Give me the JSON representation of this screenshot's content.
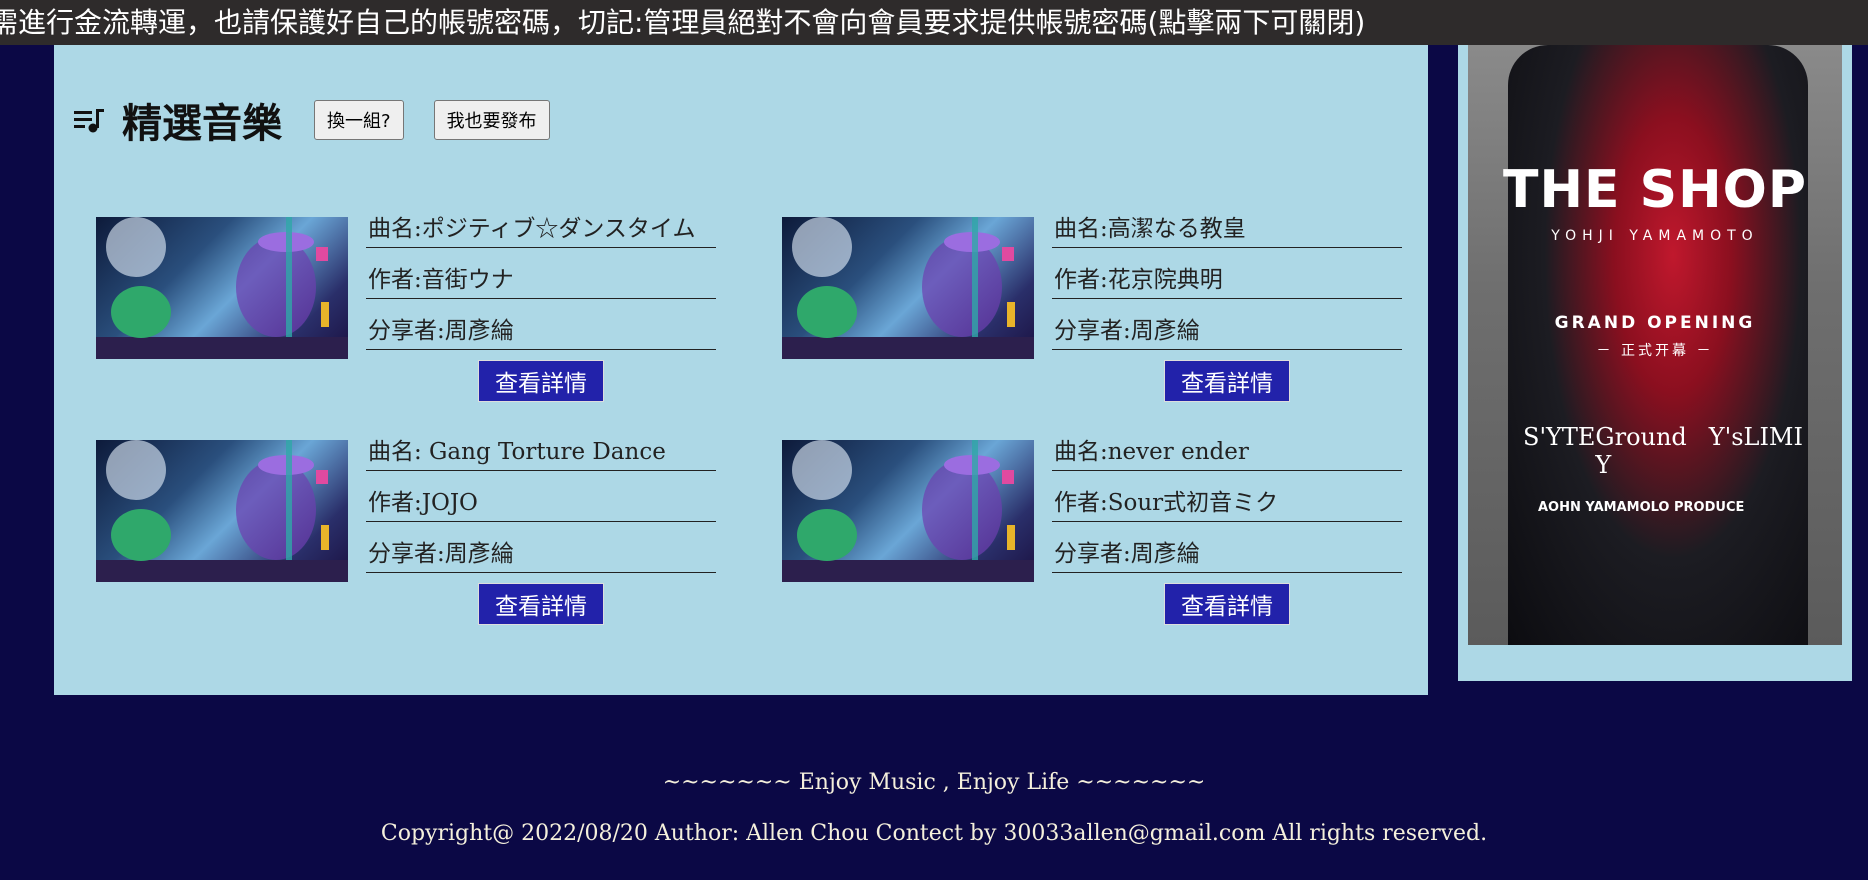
{
  "announcement": "需進行金流轉運，也請保護好自己的帳號密碼，切記:管理員絕對不會向會員要求提供帳號密碼(點擊兩下可關閉)",
  "section": {
    "icon": "playlist-music-icon",
    "title": "精選音樂",
    "shuffle_label": "換一組?",
    "publish_label": "我也要發布"
  },
  "songs": [
    {
      "title": "曲名:ポジティブ☆ダンスタイム",
      "author": "作者:音街ウナ",
      "sharer": "分享者:周彥綸",
      "button": "查看詳情"
    },
    {
      "title": "曲名:高潔なる教皇",
      "author": "作者:花京院典明",
      "sharer": "分享者:周彥綸",
      "button": "查看詳情"
    },
    {
      "title": "曲名: Gang Torture Dance",
      "author": "作者:JOJO",
      "sharer": "分享者:周彥綸",
      "button": "查看詳情"
    },
    {
      "title": "曲名:never ender",
      "author": "作者:Sour式初音ミク",
      "sharer": "分享者:周彥綸",
      "button": "查看詳情"
    }
  ],
  "ad": {
    "headline": "THE SHOP",
    "sub": "YOHJI YAMAMOTO",
    "grand": "GRAND OPENING",
    "open": "－ 正式开幕 －",
    "brands": [
      "S'YTE",
      "Ground Y",
      "Y's",
      "LIMI"
    ],
    "produce": "AOHN YAMAMOLO PRODUCE"
  },
  "footer": {
    "slogan": "~~~~~~~ Enjoy Music , Enjoy Life ~~~~~~~",
    "copyright": "Copyright@ 2022/08/20 Author: Allen Chou Contect by 30033allen@gmail.com All rights reserved."
  },
  "colors": {
    "page_bg": "#0b0845",
    "panel_bg": "#add8e6",
    "button_bg": "#2222aa",
    "marquee_bg": "#2e2b2b"
  }
}
